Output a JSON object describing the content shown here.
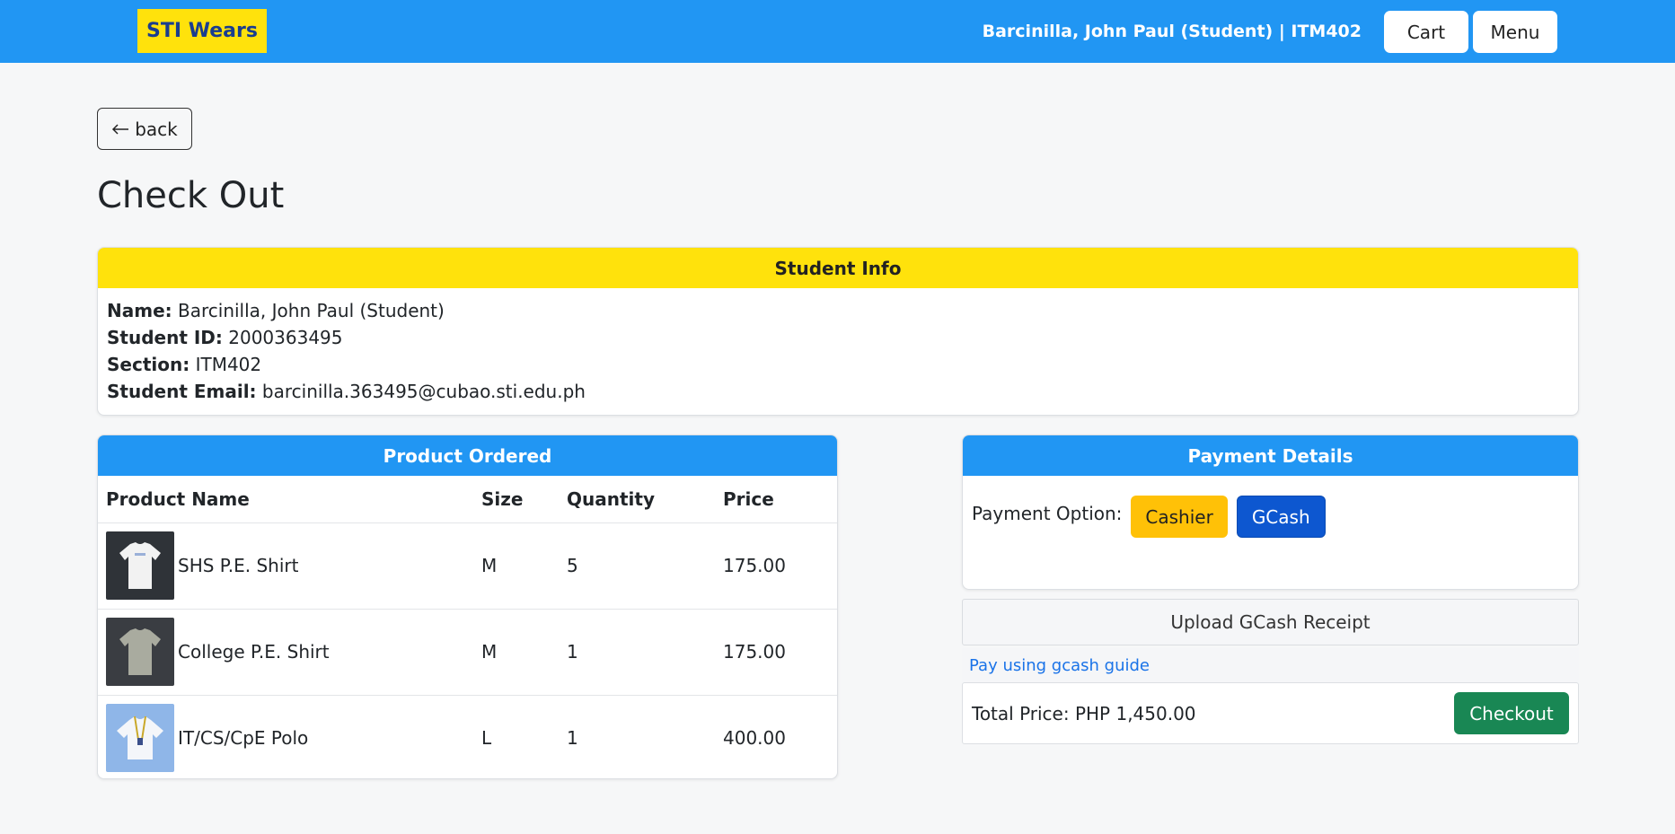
{
  "navbar": {
    "brand": "STI Wears",
    "user_info": "Barcinilla, John Paul (Student) | ITM402",
    "cart_label": "Cart",
    "menu_label": "Menu",
    "color": "#2196f3",
    "brand_bg": "#ffe20c"
  },
  "back_label": "back",
  "page_title": "Check Out",
  "student_info": {
    "header": "Student Info",
    "name_label": "Name:",
    "name": "Barcinilla, John Paul (Student)",
    "id_label": "Student ID:",
    "id": "2000363495",
    "section_label": "Section:",
    "section": "ITM402",
    "email_label": "Student Email:",
    "email": "barcinilla.363495@cubao.sti.edu.ph"
  },
  "products": {
    "header": "Product Ordered",
    "columns": [
      "Product Name",
      "Size",
      "Quantity",
      "Price"
    ],
    "rows": [
      {
        "name": "SHS P.E. Shirt",
        "size": "M",
        "quantity": "5",
        "price": "175.00",
        "icon": "white-shirt-thumbnail"
      },
      {
        "name": "College P.E. Shirt",
        "size": "M",
        "quantity": "1",
        "price": "175.00",
        "icon": "grey-shirt-thumbnail"
      },
      {
        "name": "IT/CS/CpE Polo",
        "size": "L",
        "quantity": "1",
        "price": "400.00",
        "icon": "polo-thumbnail"
      }
    ]
  },
  "payment": {
    "header": "Payment Details",
    "option_label": "Payment Option:",
    "cashier_label": "Cashier",
    "gcash_label": "GCash",
    "upload_label": "Upload GCash Receipt",
    "guide_link": "Pay using gcash guide",
    "total_label": "Total Price: PHP 1,450.00",
    "checkout_label": "Checkout"
  }
}
